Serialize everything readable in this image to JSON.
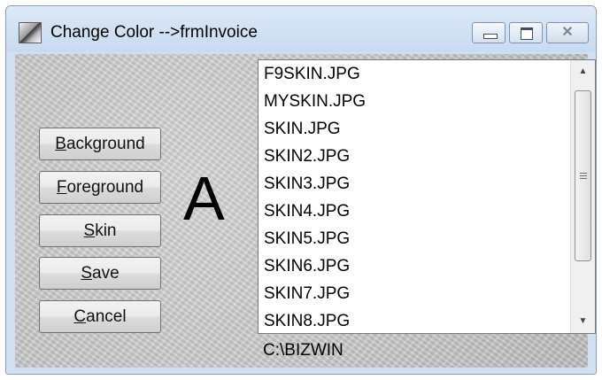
{
  "window": {
    "title": "Change Color -->frmInvoice",
    "controls": {
      "minimize_icon": "minimize-icon",
      "maximize_icon": "maximize-icon",
      "close_glyph": "✕"
    }
  },
  "buttons": [
    {
      "label_accel": "B",
      "label_rest": "ackground"
    },
    {
      "label_accel": "F",
      "label_rest": "oreground"
    },
    {
      "label_accel": "S",
      "label_rest": "kin"
    },
    {
      "label_accel": "S",
      "label_rest": "ave"
    },
    {
      "label_accel": "C",
      "label_rest": "ancel"
    }
  ],
  "preview": {
    "letter": "A"
  },
  "file_list": {
    "items": [
      "F9SKIN.JPG",
      "MYSKIN.JPG",
      "SKIN.JPG",
      "SKIN2.JPG",
      "SKIN3.JPG",
      "SKIN4.JPG",
      "SKIN5.JPG",
      "SKIN6.JPG",
      "SKIN7.JPG",
      "SKIN8.JPG"
    ],
    "scroll_up_glyph": "▲",
    "scroll_down_glyph": "▼"
  },
  "path": "C:\\BIZWIN"
}
